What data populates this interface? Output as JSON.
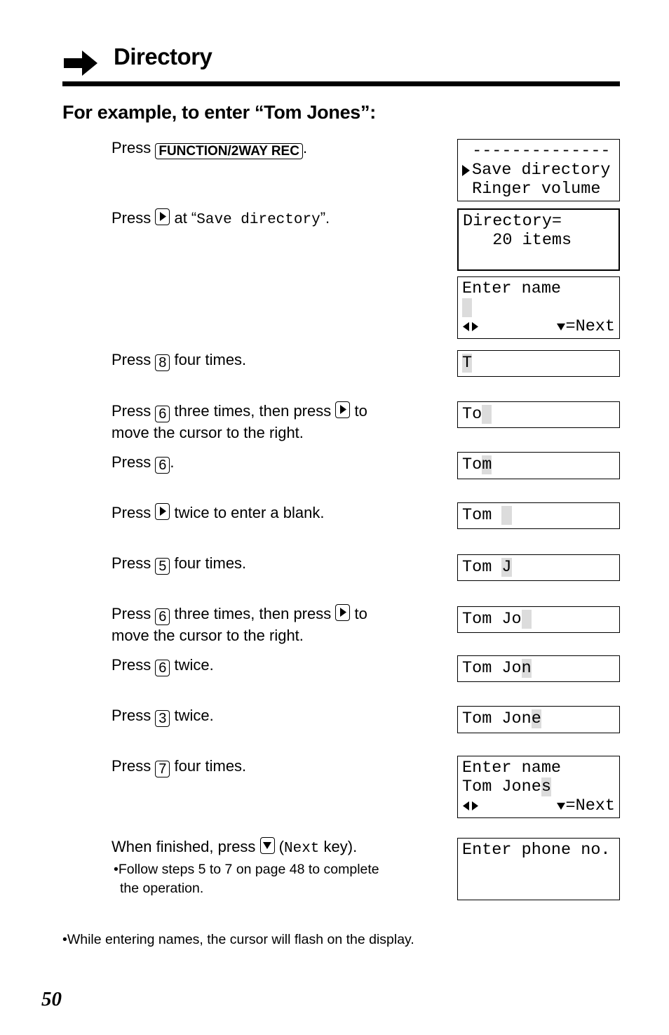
{
  "header": {
    "title": "Directory",
    "icon": "right-arrow-icon"
  },
  "subheading": "For example, to enter “Tom Jones”:",
  "steps": [
    [
      {
        "t": "Press "
      },
      {
        "key": "FUNCTION/2WAY REC",
        "wide": true
      },
      {
        "t": "."
      }
    ],
    [
      {
        "t": "Press "
      },
      {
        "icon": "right"
      },
      {
        "t": " at “"
      },
      {
        "mono": "Save directory"
      },
      {
        "t": "”."
      }
    ],
    [
      {
        "t": "Press "
      },
      {
        "key": "8"
      },
      {
        "t": " four times."
      }
    ],
    [
      {
        "t": "Press "
      },
      {
        "key": "6"
      },
      {
        "t": " three times, then press "
      },
      {
        "icon": "right"
      },
      {
        "t": " to"
      },
      {
        "br": true
      },
      {
        "t": "move the cursor to the right."
      }
    ],
    [
      {
        "t": "Press "
      },
      {
        "key": "6"
      },
      {
        "t": "."
      }
    ],
    [
      {
        "t": "Press "
      },
      {
        "icon": "right"
      },
      {
        "t": " twice to enter a blank."
      }
    ],
    [
      {
        "t": "Press "
      },
      {
        "key": "5"
      },
      {
        "t": " four times."
      }
    ],
    [
      {
        "t": "Press "
      },
      {
        "key": "6"
      },
      {
        "t": " three times, then press "
      },
      {
        "icon": "right"
      },
      {
        "t": " to"
      },
      {
        "br": true
      },
      {
        "t": "move the cursor to the right."
      }
    ],
    [
      {
        "t": "Press "
      },
      {
        "key": "6"
      },
      {
        "t": " twice."
      }
    ],
    [
      {
        "t": "Press "
      },
      {
        "key": "3"
      },
      {
        "t": " twice."
      }
    ],
    [
      {
        "t": "Press "
      },
      {
        "key": "7"
      },
      {
        "t": " four times."
      }
    ],
    [
      {
        "t": "When finished, press "
      },
      {
        "icon": "down"
      },
      {
        "t": " ("
      },
      {
        "mono": "Next"
      },
      {
        "t": " key)."
      }
    ]
  ],
  "step_note": [
    "•Follow steps 5 to 7 on page 48 to complete",
    "the operation."
  ],
  "displays": [
    {
      "lines": [
        {
          "text": " --------------"
        },
        {
          "selected": true,
          "text": "Save directory"
        },
        {
          "text": " Ringer volume"
        }
      ]
    },
    {
      "lines": [
        {
          "text": "Directory="
        },
        {
          "text": "   20 items"
        }
      ]
    },
    {
      "lines": [
        {
          "text": "Enter name"
        },
        {
          "text": "",
          "cursor": " "
        },
        {
          "nav": true,
          "next": "=Next"
        }
      ]
    },
    {
      "lines": [
        {
          "text": "",
          "cursor": "T"
        }
      ]
    },
    {
      "lines": [
        {
          "text": "To",
          "cursor": " "
        }
      ]
    },
    {
      "lines": [
        {
          "text": "To",
          "cursor": "m"
        }
      ]
    },
    {
      "lines": [
        {
          "text": "Tom ",
          "cursor": " "
        }
      ]
    },
    {
      "lines": [
        {
          "text": "Tom ",
          "cursor": "J"
        }
      ]
    },
    {
      "lines": [
        {
          "text": "Tom Jo",
          "cursor": " "
        }
      ]
    },
    {
      "lines": [
        {
          "text": "Tom Jo",
          "cursor": "n"
        }
      ]
    },
    {
      "lines": [
        {
          "text": "Tom Jon",
          "cursor": "e"
        }
      ]
    },
    {
      "lines": [
        {
          "text": "Enter name"
        },
        {
          "text": "Tom Jone",
          "cursor": "s"
        },
        {
          "nav": true,
          "next": "=Next"
        }
      ]
    },
    {
      "lines": [
        {
          "text": "Enter phone no."
        }
      ]
    }
  ],
  "footer_note": "•While entering names, the cursor will flash on the display.",
  "page_number": "50"
}
